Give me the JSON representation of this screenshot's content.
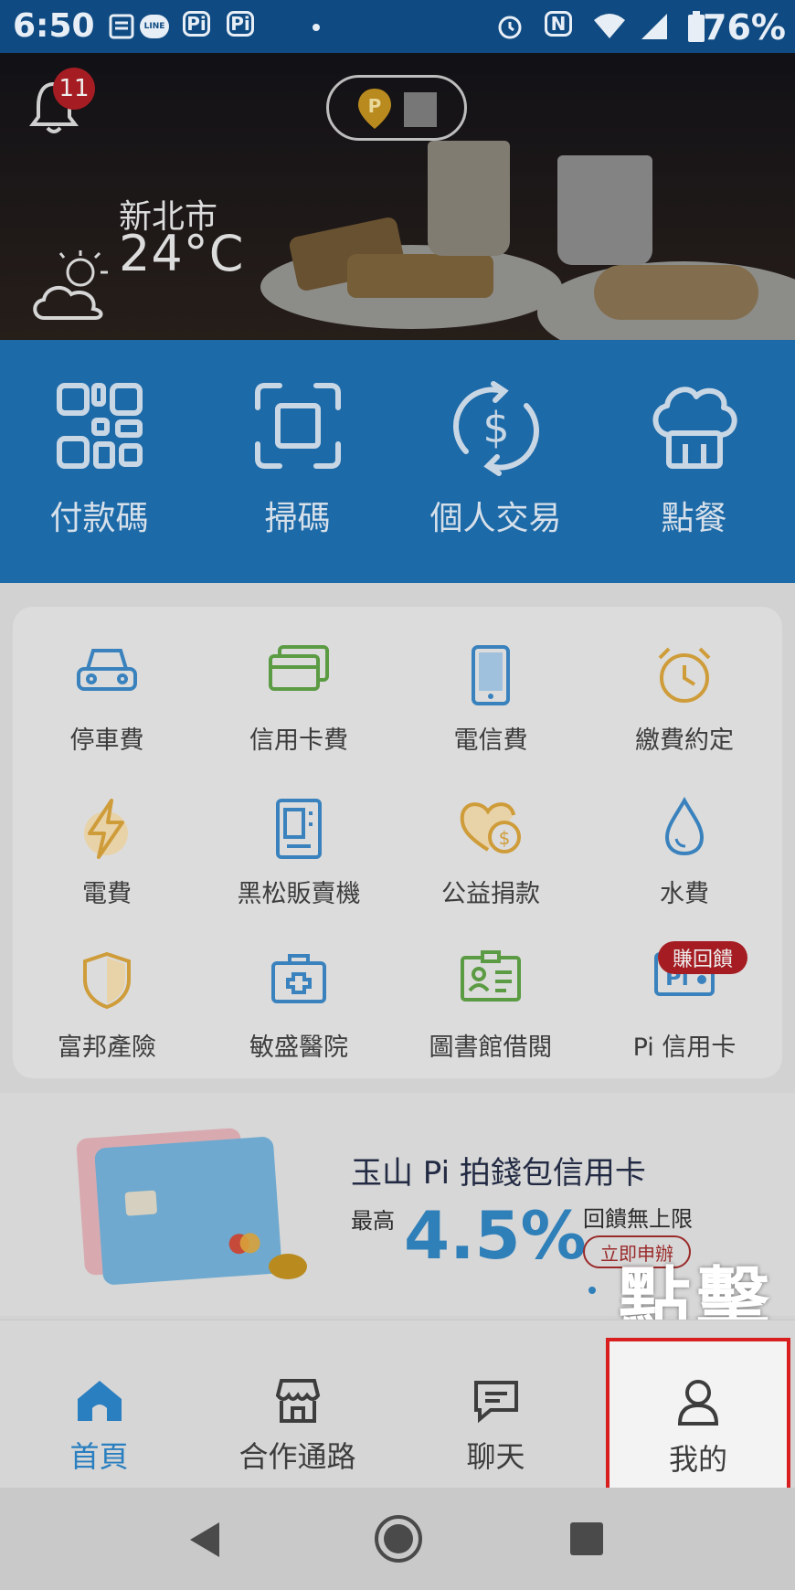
{
  "status_bar": {
    "time": "6:50",
    "icons": [
      "notes-icon",
      "line-icon",
      "pi-icon",
      "pi-icon",
      "dot-icon",
      "alarm-icon",
      "nfc-icon",
      "wifi-icon",
      "signal-icon",
      "battery-icon"
    ],
    "line_label": "LINE",
    "pi_label": "Pi",
    "nfc_label": "N",
    "battery": "76%"
  },
  "hero": {
    "notification_count": "11",
    "weather_city": "新北市",
    "weather_temp": "24°C"
  },
  "quick_actions": [
    {
      "label": "付款碼",
      "icon": "qr-code-icon"
    },
    {
      "label": "掃碼",
      "icon": "scan-icon"
    },
    {
      "label": "個人交易",
      "icon": "dollar-exchange-icon"
    },
    {
      "label": "點餐",
      "icon": "chef-hat-icon"
    }
  ],
  "services": [
    {
      "label": "停車費",
      "icon": "car-icon"
    },
    {
      "label": "信用卡費",
      "icon": "credit-card-icon"
    },
    {
      "label": "電信費",
      "icon": "phone-icon"
    },
    {
      "label": "繳費約定",
      "icon": "alarm-clock-icon"
    },
    {
      "label": "電費",
      "icon": "lightning-icon"
    },
    {
      "label": "黑松販賣機",
      "icon": "vending-machine-icon"
    },
    {
      "label": "公益捐款",
      "icon": "donation-icon"
    },
    {
      "label": "水費",
      "icon": "water-drop-icon"
    },
    {
      "label": "富邦產險",
      "icon": "shield-icon"
    },
    {
      "label": "敏盛醫院",
      "icon": "medical-kit-icon"
    },
    {
      "label": "圖書館借閱",
      "icon": "library-card-icon"
    },
    {
      "label": "Pi 信用卡",
      "icon": "pi-card-icon"
    }
  ],
  "pi_card_badge": "賺回饋",
  "pi_card_icon_text": "Pi",
  "promo": {
    "title": "玉山 Pi 拍錢包信用卡",
    "prefix": "最高",
    "rate": "4.5%",
    "sub": "回饋無上限",
    "cta": "立即申辦"
  },
  "click_hint": "點擊",
  "bottom_nav": [
    {
      "label": "首頁",
      "icon": "home-icon",
      "active": true
    },
    {
      "label": "合作通路",
      "icon": "store-icon",
      "active": false
    },
    {
      "label": "聊天",
      "icon": "chat-icon",
      "active": false
    },
    {
      "label": "我的",
      "icon": "user-icon",
      "active": false
    }
  ],
  "colors": {
    "brand_blue": "#1d6aa8",
    "status_blue": "#0f4a82",
    "active_nav": "#2a7fc0",
    "highlight_red": "#d81e1e"
  }
}
